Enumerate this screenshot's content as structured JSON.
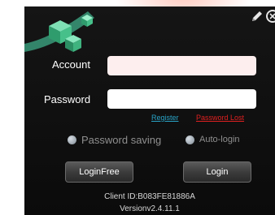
{
  "login": {
    "account_label": "Account",
    "account_value": "",
    "password_label": "Password",
    "password_value": "",
    "register_link": "Register",
    "password_lost_link": "Password Lost",
    "password_saving_label": "Password saving",
    "auto_login_label": "Auto-login",
    "loginfree_button": "LoginFree",
    "login_button": "Login",
    "client_id": "Client ID:B083FE81886A",
    "version": "Versionv2.4.11.1"
  },
  "icons": {
    "logo": "green-cubes-logo",
    "edit": "pencil-icon",
    "close": "close-icon"
  },
  "colors": {
    "panel_bg": "#111111",
    "account_field_bg": "#fdeeee",
    "password_field_bg": "#ffffff",
    "register_link": "#29a3c6",
    "password_lost_link": "#e02020",
    "logo_green": "#3dbf8a"
  }
}
